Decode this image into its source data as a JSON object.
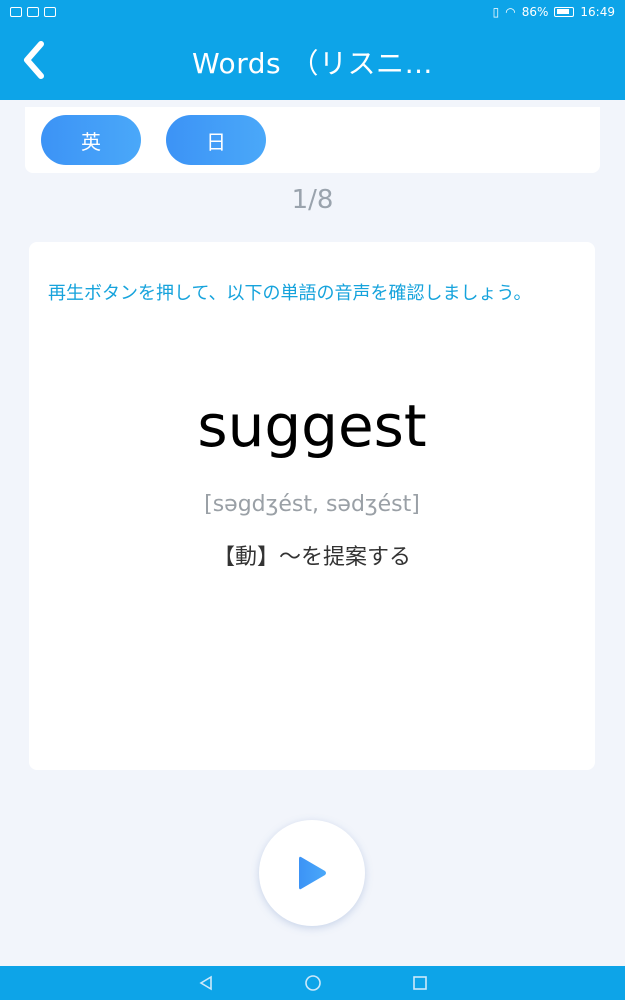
{
  "status_bar": {
    "battery": "86%",
    "time": "16:49"
  },
  "header": {
    "title": "Words （リスニ…"
  },
  "lang_toggle": {
    "english_label": "英",
    "japanese_label": "日"
  },
  "progress": {
    "counter": "1/8"
  },
  "card": {
    "instruction": "再生ボタンを押して、以下の単語の音声を確認しましょう。",
    "word": "suggest",
    "pronunciation": "[səgdʒést, sədʒést]",
    "meaning": "【動】～を提案する"
  },
  "colors": {
    "primary": "#0da4e8",
    "button_gradient_start": "#3c93f6",
    "button_gradient_end": "#4aa8f9",
    "instruction_text": "#16a3dc"
  },
  "icons": {
    "back": "chevron-left-icon",
    "play": "play-icon"
  }
}
